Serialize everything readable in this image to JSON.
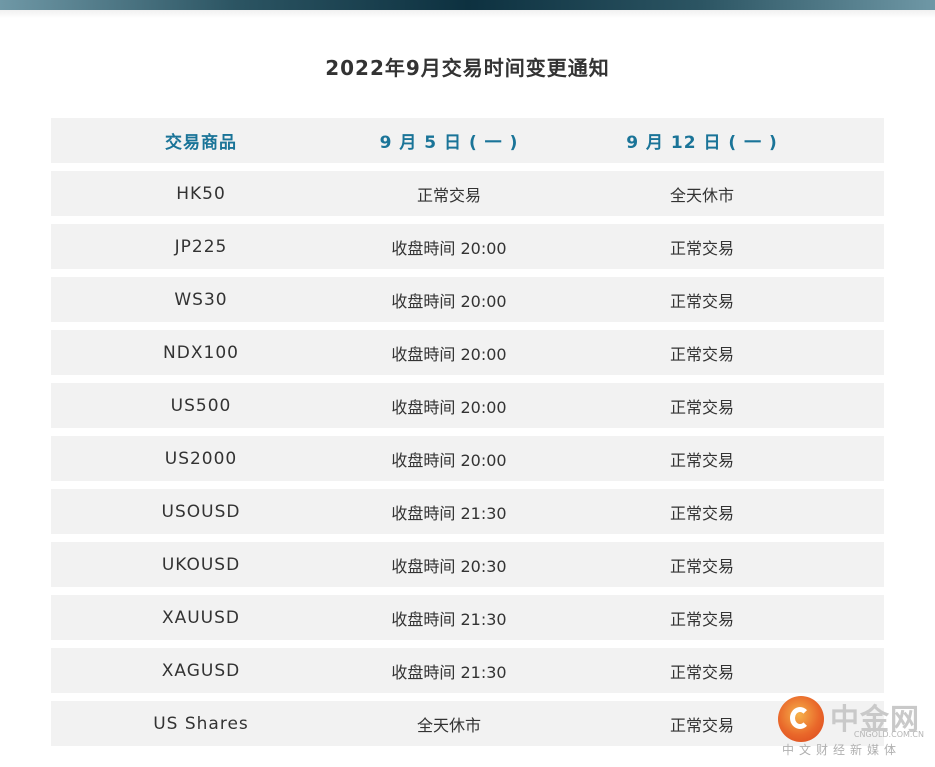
{
  "title": "2022年9月交易时间变更通知",
  "table": {
    "headers": [
      "交易商品",
      "9 月 5 日 ( 一 )",
      "9 月 12 日 ( 一 )"
    ],
    "rows": [
      [
        "HK50",
        "正常交易",
        "全天休市"
      ],
      [
        "JP225",
        "收盘時间 20:00",
        "正常交易"
      ],
      [
        "WS30",
        "收盘時间 20:00",
        "正常交易"
      ],
      [
        "NDX100",
        "收盘時间 20:00",
        "正常交易"
      ],
      [
        "US500",
        "收盘時间 20:00",
        "正常交易"
      ],
      [
        "US2000",
        "收盘時间 20:00",
        "正常交易"
      ],
      [
        "USOUSD",
        "收盘時间 21:30",
        "正常交易"
      ],
      [
        "UKOUSD",
        "收盘時间 20:30",
        "正常交易"
      ],
      [
        "XAUUSD",
        "收盘時间 21:30",
        "正常交易"
      ],
      [
        "XAGUSD",
        "收盘時间 21:30",
        "正常交易"
      ],
      [
        "US Shares",
        "全天休市",
        "正常交易"
      ]
    ]
  },
  "watermark": {
    "name": "中金网",
    "url": "CNGOLD.COM.CN",
    "subtitle": "中文财经新媒体"
  },
  "colors": {
    "header_text": "#1a7498",
    "row_background": "#f2f2f2",
    "top_bar": "#0d3140"
  }
}
